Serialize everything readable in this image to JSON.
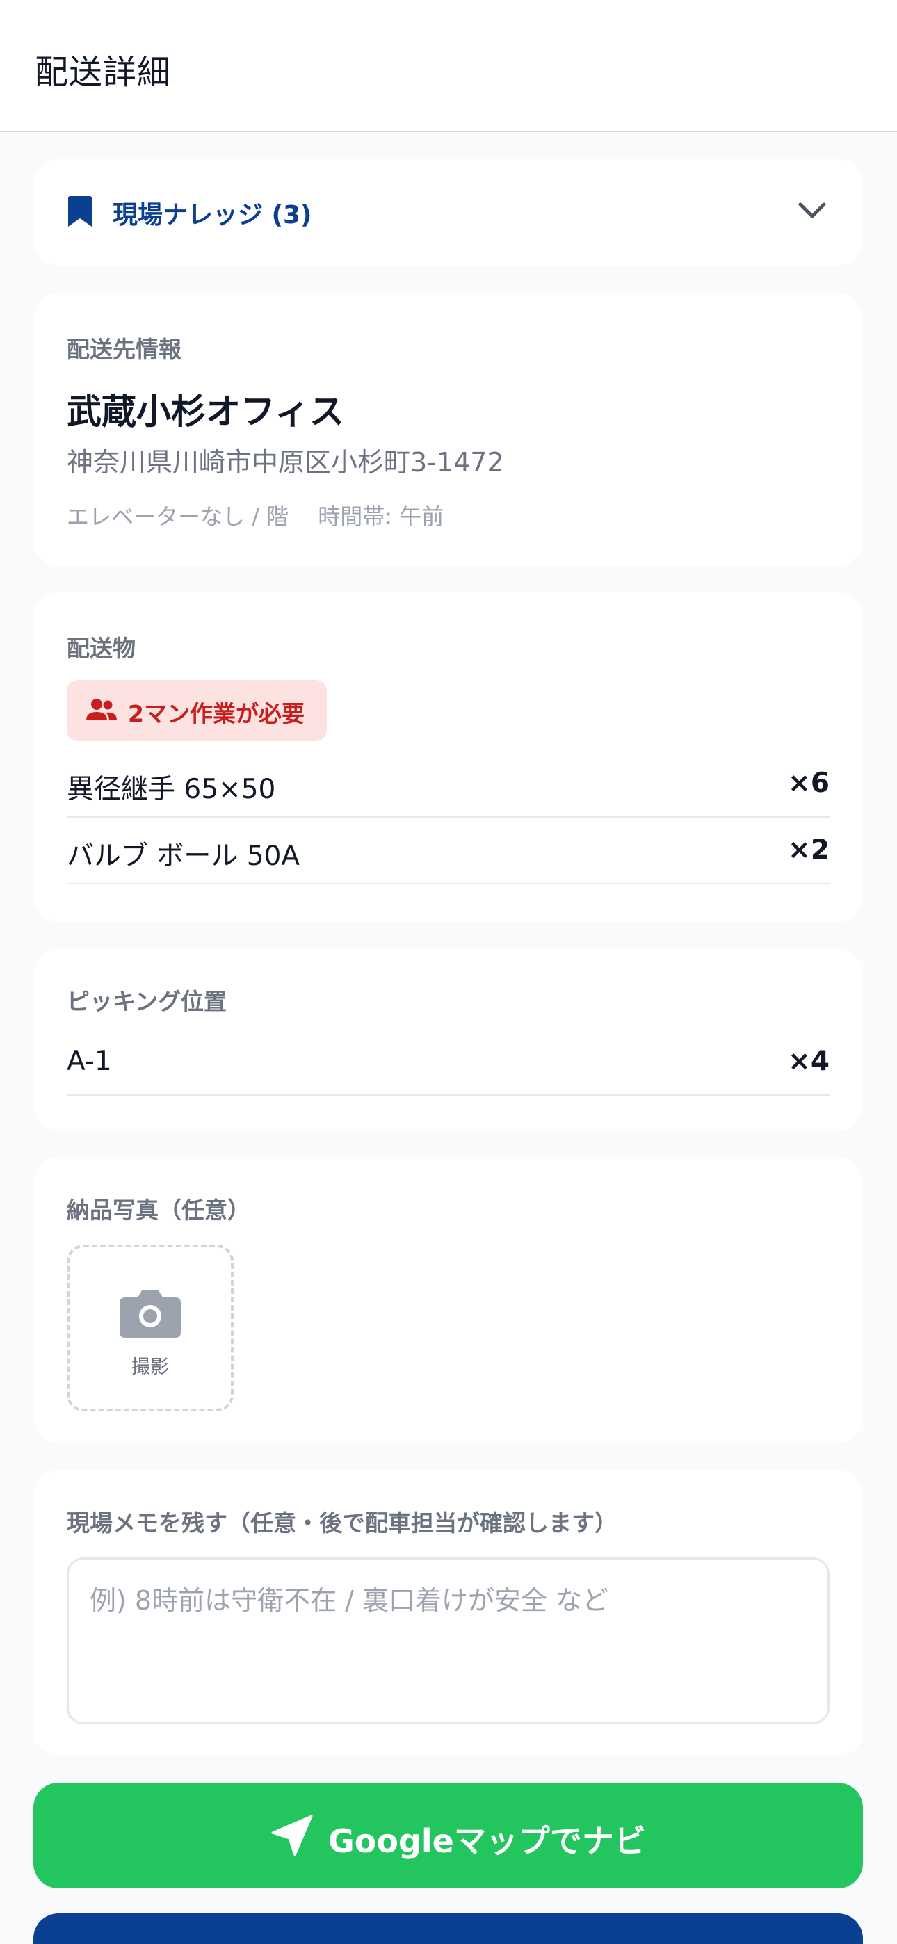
{
  "header": {
    "title": "配送詳細"
  },
  "knowledge": {
    "label": "現場ナレッジ (3)"
  },
  "destination": {
    "section_label": "配送先情報",
    "name": "武蔵小杉オフィス",
    "address": "神奈川県川崎市中原区小杉町3-1472",
    "meta": "エレベーターなし / 階　 時間帯: 午前"
  },
  "items": {
    "section_label": "配送物",
    "badge": "2マン作業が必要",
    "rows": [
      {
        "name": "異径継手 65×50",
        "qty": "×6"
      },
      {
        "name": "バルブ ボール 50A",
        "qty": "×2"
      }
    ]
  },
  "picking": {
    "section_label": "ピッキング位置",
    "rows": [
      {
        "name": "A-1",
        "qty": "×4"
      }
    ]
  },
  "photo": {
    "section_label": "納品写真（任意）",
    "capture_label": "撮影"
  },
  "memo": {
    "section_label": "現場メモを残す（任意・後で配車担当が確認します）",
    "placeholder": "例) 8時前は守衛不在 / 裏口着けが安全 など",
    "value": ""
  },
  "actions": {
    "navigate_label": "Googleマップでナビ"
  },
  "colors": {
    "accent_blue": "#0b3f91",
    "nav_green": "#22c55e",
    "warning_bg": "#fde2e2",
    "warning_text": "#c81e1e"
  },
  "icons": {
    "knowledge": "bookmark-icon",
    "expand": "chevron-down-icon",
    "badge": "users-icon",
    "photo": "camera-icon",
    "navigate": "navigation-arrow-icon"
  }
}
